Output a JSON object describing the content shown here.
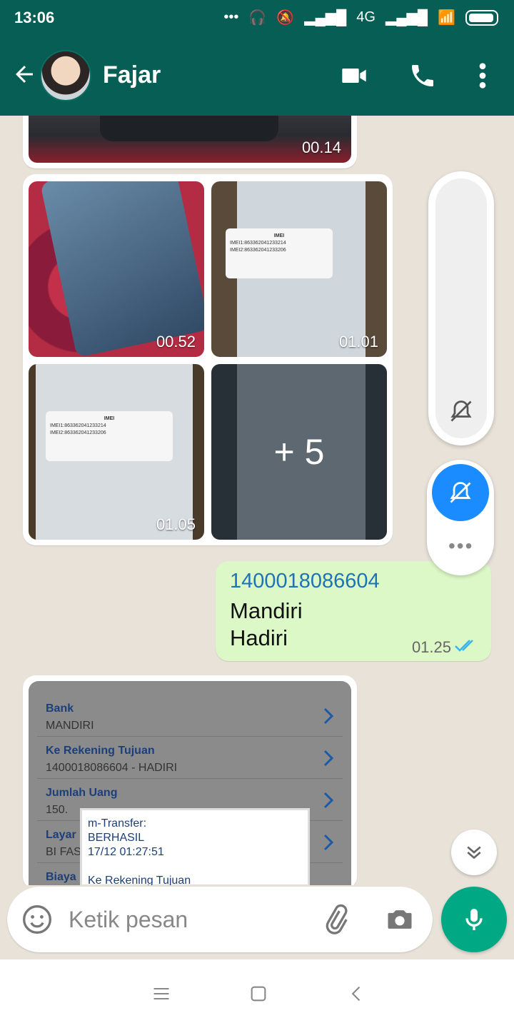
{
  "status_bar": {
    "time": "13:06",
    "network": "4G"
  },
  "header": {
    "contact_name": "Fajar"
  },
  "messages": {
    "video_top_time": "00.14",
    "grid": {
      "tiles": [
        {
          "time": "00.52"
        },
        {
          "time": "01.01",
          "dialog_title": "IMEI",
          "dialog_lines": [
            "IMEI1:863362041233214",
            "IMEI2:863362041233206"
          ]
        },
        {
          "time": "01.05",
          "dialog_title": "IMEI",
          "dialog_lines": [
            "IMEI1:863362041233214",
            "IMEI2:863362041233206"
          ]
        },
        {
          "more_count": "+ 5"
        }
      ]
    },
    "outgoing": {
      "account_number": "1400018086604",
      "bank": "Mandiri",
      "name": "Hadiri",
      "time": "01.25"
    },
    "bank_screenshot": {
      "rows": [
        {
          "title": "Bank",
          "value": "MANDIRI"
        },
        {
          "title": "Ke Rekening Tujuan",
          "value": "1400018086604 - HADIRI"
        },
        {
          "title": "Jumlah Uang",
          "value": "150."
        },
        {
          "title": "Layar",
          "value": "BI FAS"
        },
        {
          "title": "Biaya",
          "value": ""
        }
      ],
      "toast": {
        "line1": "m-Transfer:",
        "line2": "BERHASIL",
        "line3": "17/12 01:27:51",
        "line4": "Ke Rekening Tujuan"
      }
    }
  },
  "compose": {
    "placeholder": "Ketik pesan"
  },
  "colors": {
    "header": "#075e54",
    "outgoing_bubble": "#dcf8c6",
    "mic_button": "#00a884",
    "link_blue": "#1e73b8"
  }
}
